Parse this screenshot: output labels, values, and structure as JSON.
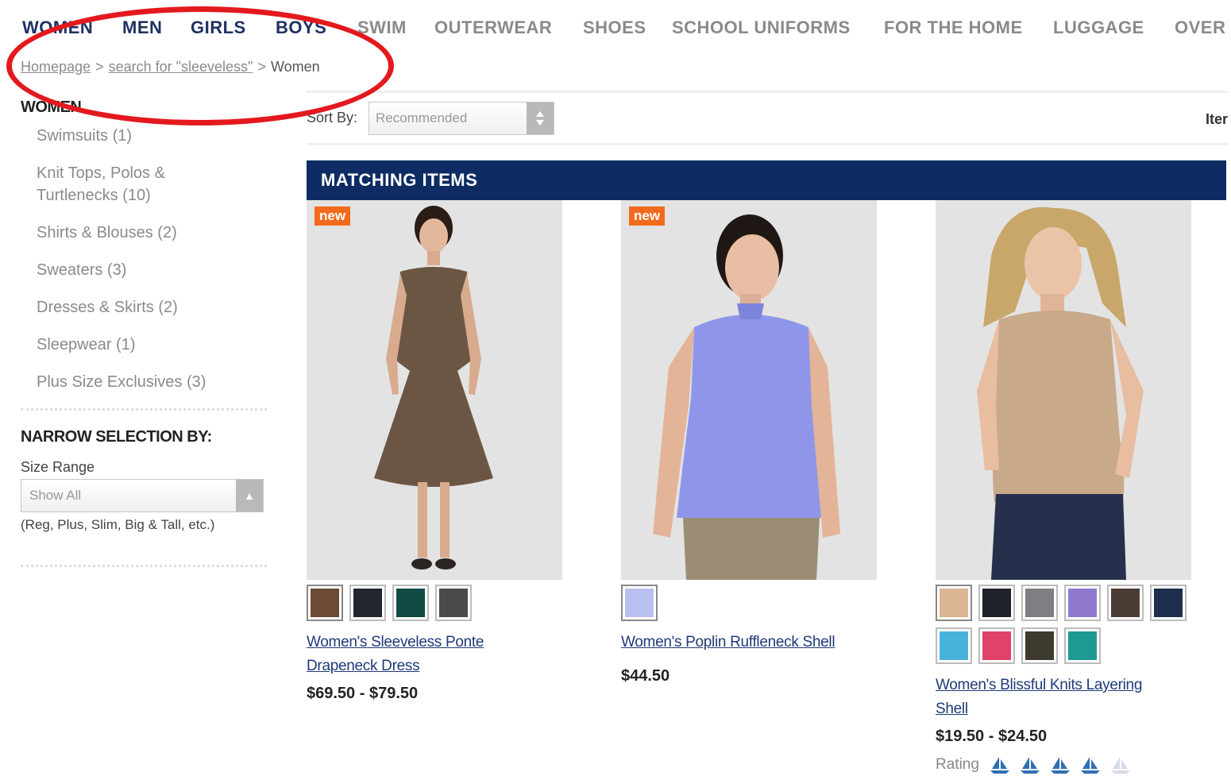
{
  "nav": {
    "items": [
      "WOMEN",
      "MEN",
      "GIRLS",
      "BOYS",
      "SWIM",
      "OUTERWEAR",
      "SHOES",
      "SCHOOL UNIFORMS",
      "FOR THE HOME",
      "LUGGAGE",
      "OVER"
    ]
  },
  "breadcrumb": {
    "home": "Homepage",
    "search": "search for \"sleeveless\"",
    "current": "Women",
    "sep": ">"
  },
  "sidebar": {
    "title": "WOMEN",
    "items": [
      "Swimsuits (1)",
      "Knit Tops, Polos & Turtlenecks (10)",
      "Shirts & Blouses (2)",
      "Sweaters (3)",
      "Dresses & Skirts (2)",
      "Sleepwear (1)",
      "Plus Size Exclusives (3)"
    ],
    "narrow_title": "NARROW SELECTION BY:",
    "size_label": "Size Range",
    "size_value": "Show All",
    "size_hint": "(Reg, Plus, Slim, Big & Tall, etc.)"
  },
  "sort": {
    "label": "Sort By:",
    "value": "Recommended",
    "items_label": "Iter"
  },
  "matching": {
    "title": "MATCHING ITEMS"
  },
  "products": [
    {
      "badge": "new",
      "name_line1": "Women's Sleeveless Ponte",
      "name_line2": "Drapeneck Dress",
      "price": "$69.50 - $79.50",
      "swatches": [
        "#6b4a36",
        "#22262e",
        "#124a44",
        "#4a4a4a"
      ]
    },
    {
      "badge": "new",
      "name_line1": "Women's Poplin Ruffleneck Shell",
      "name_line2": "",
      "price": "$44.50",
      "swatches": [
        "#b8c0f2"
      ]
    },
    {
      "badge": "",
      "name_line1": "Women's Blissful Knits Layering",
      "name_line2": "Shell",
      "price": "$19.50 - $24.50",
      "swatches": [
        "#d9b591",
        "#1f222b",
        "#7d7f84",
        "#8f79cf",
        "#4a3c35",
        "#1f2d4f",
        "#47b3dc",
        "#e0426a",
        "#3e3a2e",
        "#1f9a93"
      ],
      "rating_label": "Rating",
      "rating": 4
    }
  ],
  "colors": {
    "nav_dark": "#1f3163",
    "matching_bar": "#0e2c63",
    "badge": "#f26b1d",
    "highlight": "#e3191e"
  }
}
